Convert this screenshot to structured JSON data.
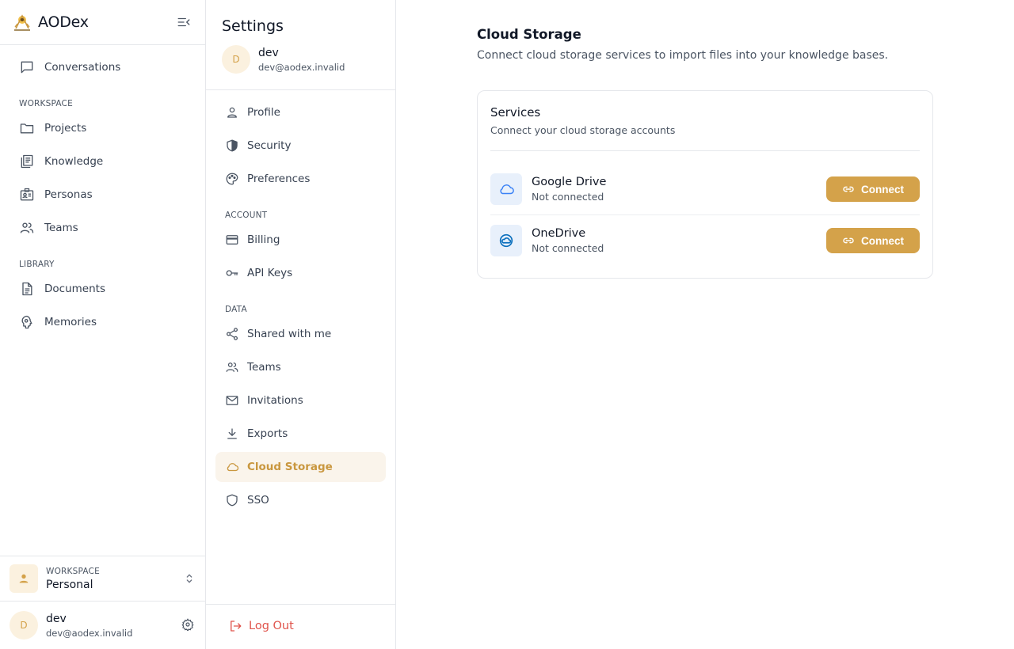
{
  "app": {
    "name": "AODex",
    "colors": {
      "accent": "#d4a24a",
      "danger": "#e0544c",
      "accent_bg": "#faf4eb"
    }
  },
  "sidebar": {
    "top_item": {
      "label": "Conversations",
      "icon": "chat-bubble-icon"
    },
    "sections": [
      {
        "header": "WORKSPACE",
        "items": [
          {
            "label": "Projects",
            "icon": "folder-icon"
          },
          {
            "label": "Knowledge",
            "icon": "book-stack-icon"
          },
          {
            "label": "Personas",
            "icon": "id-badge-icon"
          },
          {
            "label": "Teams",
            "icon": "users-icon"
          }
        ]
      },
      {
        "header": "LIBRARY",
        "items": [
          {
            "label": "Documents",
            "icon": "document-icon"
          },
          {
            "label": "Memories",
            "icon": "brain-icon"
          }
        ]
      }
    ],
    "workspace": {
      "caption": "WORKSPACE",
      "name": "Personal"
    },
    "user": {
      "initial": "D",
      "name": "dev",
      "email": "dev@aodex.invalid"
    }
  },
  "settings": {
    "title": "Settings",
    "user": {
      "initial": "D",
      "name": "dev",
      "email": "dev@aodex.invalid"
    },
    "items": [
      {
        "label": "Profile",
        "icon": "person-icon"
      },
      {
        "label": "Security",
        "icon": "shield-half-icon"
      },
      {
        "label": "Preferences",
        "icon": "palette-icon"
      }
    ],
    "account": {
      "header": "ACCOUNT",
      "items": [
        {
          "label": "Billing",
          "icon": "credit-card-icon"
        },
        {
          "label": "API Keys",
          "icon": "key-icon"
        }
      ]
    },
    "data": {
      "header": "DATA",
      "items": [
        {
          "label": "Shared with me",
          "icon": "share-icon"
        },
        {
          "label": "Teams",
          "icon": "users-icon"
        },
        {
          "label": "Invitations",
          "icon": "mail-icon"
        },
        {
          "label": "Exports",
          "icon": "download-icon"
        },
        {
          "label": "Cloud Storage",
          "icon": "cloud-icon",
          "active": true
        },
        {
          "label": "SSO",
          "icon": "shield-icon"
        }
      ]
    },
    "logout_label": "Log Out"
  },
  "main": {
    "title": "Cloud Storage",
    "subtitle": "Connect cloud storage services to import files into your knowledge bases.",
    "card": {
      "title": "Services",
      "subtitle": "Connect your cloud storage accounts",
      "services": [
        {
          "name": "Google Drive",
          "status": "Not connected",
          "icon": "cloud-icon",
          "button": "Connect"
        },
        {
          "name": "OneDrive",
          "status": "Not connected",
          "icon": "onedrive-icon",
          "button": "Connect"
        }
      ]
    }
  }
}
